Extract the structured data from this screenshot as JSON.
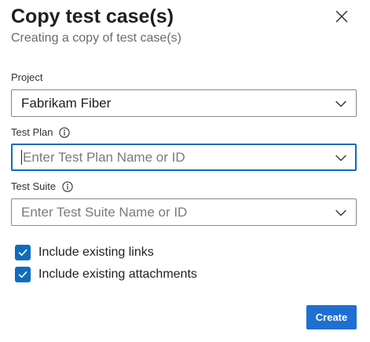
{
  "dialog": {
    "title": "Copy test case(s)",
    "subtitle": "Creating a copy of test case(s)"
  },
  "project": {
    "label": "Project",
    "value": "Fabrikam Fiber"
  },
  "test_plan": {
    "label": "Test Plan",
    "placeholder": "Enter Test Plan Name or ID",
    "value": ""
  },
  "test_suite": {
    "label": "Test Suite",
    "placeholder": "Enter Test Suite Name or ID",
    "value": ""
  },
  "options": {
    "include_links": {
      "label": "Include existing links",
      "checked": true
    },
    "include_attachments": {
      "label": "Include existing attachments",
      "checked": true
    }
  },
  "actions": {
    "create_label": "Create"
  },
  "colors": {
    "accent": "#0f6cbd",
    "primary_button": "#1f6fd1",
    "placeholder_text": "#7a7a7a",
    "subtitle_text": "#6b6b6b"
  },
  "icons": {
    "close": "close-icon",
    "info": "info-icon",
    "chevron": "chevron-down-icon",
    "check": "checkmark-icon"
  }
}
